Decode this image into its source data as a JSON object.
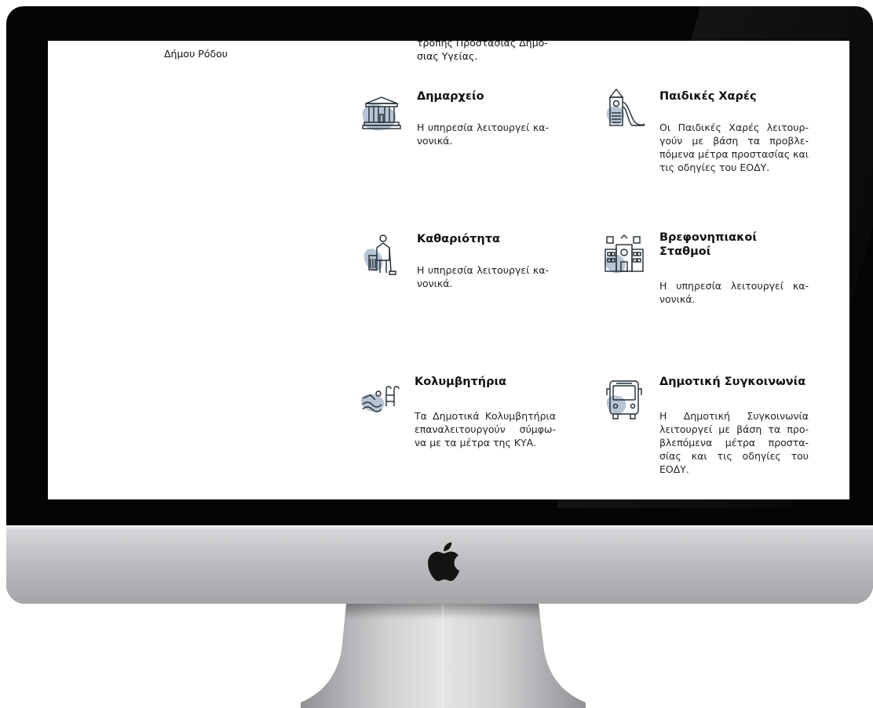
{
  "screen": {
    "top_fragment_line1": "τροπής Προστασίας Δημό-",
    "top_fragment_line2": "σιας Υγείας.",
    "left_label": "Δήμου Ρόδου"
  },
  "services": [
    {
      "title": "Δημαρχείο",
      "text": "Η υπηρεσία λειτουργεί κα-νονικά.",
      "icon": "city-hall-icon"
    },
    {
      "title": "Παιδικές Χαρές",
      "text": "Οι Παιδικές Χαρές λειτουρ-γούν με βάση τα προβλε-πόμενα μέτρα προστασίας και τις οδηγίες του ΕΟΔΥ.",
      "icon": "playground-slide-icon"
    },
    {
      "title": "Καθαριότητα",
      "text": "Η υπηρεσία λειτουργεί κα-νονικά.",
      "icon": "cleaner-icon"
    },
    {
      "title": "Βρεφονηπιακοί Σταθμοί",
      "text": "Η υπηρεσία λειτουργεί κα-νονικά.",
      "icon": "nursery-building-icon"
    },
    {
      "title": "Κολυμβητήρια",
      "text": "Τα Δημοτικά Κολυμβητήρια επαναλειτουργούν σύμφω-να με τα μέτρα της ΚΥΑ.",
      "icon": "swimming-pool-icon"
    },
    {
      "title": "Δημοτική Συγκοινωνία",
      "text": "Η Δημοτική Συγκοινωνία λειτουργεί με βάση τα προ-βλεπόμενα μέτρα προστα-σίας και τις οδηγίες του ΕΟΔΥ.",
      "icon": "bus-icon"
    }
  ],
  "device": {
    "logo": "apple-logo-icon"
  },
  "colors": {
    "icon_blob": "#b7c4d3",
    "bezel": "#050505",
    "chin": "#bcbec1"
  }
}
